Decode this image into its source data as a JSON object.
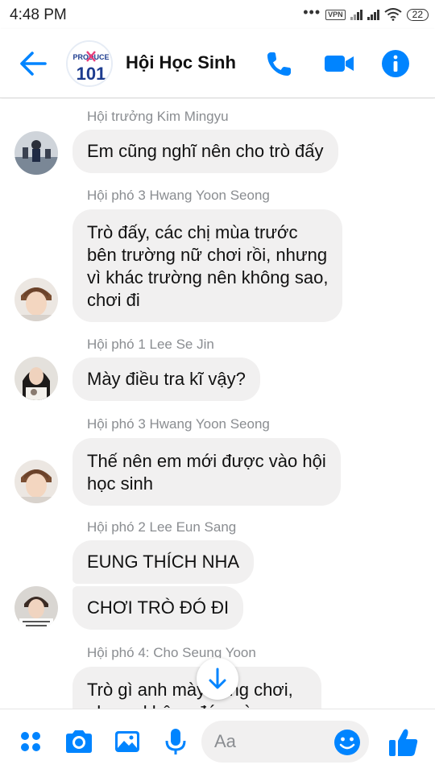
{
  "status_bar": {
    "time": "4:48 PM",
    "vpn_label": "VPN",
    "battery": "22"
  },
  "header": {
    "title": "Hội Học Sinh",
    "group_logo_top": "PRODUCE",
    "group_logo_bottom": "101"
  },
  "messages": [
    {
      "sender": "Hội trưởng Kim Mingyu",
      "lines": [
        "Em cũng nghĩ nên cho trò đấy"
      ]
    },
    {
      "sender": "Hội phó 3 Hwang Yoon Seong",
      "lines": [
        "Trò đấy, các chị mùa trước",
        "bên trường nữ chơi rồi, nhưng",
        "vì khác trường nên không sao,",
        "chơi đi"
      ]
    },
    {
      "sender": "Hội phó 1 Lee Se Jin",
      "lines": [
        "Mày điều tra kĩ vậy?"
      ]
    },
    {
      "sender": "Hội phó 3 Hwang Yoon Seong",
      "lines": [
        "Thế nên em mới được vào hội",
        "học sinh"
      ]
    },
    {
      "sender": "Hội phó 2 Lee Eun Sang",
      "lines": [
        "EUNG THÍCH NHA"
      ]
    },
    {
      "sender": "",
      "lines": [
        "CHƠI TRÒ ĐÓ ĐI"
      ]
    },
    {
      "sender": "Hội phó 4: Cho Seung Yoon",
      "lines": [
        "Trò gì anh mày cũng chơi,",
        "nhưng không đứa nào quen"
      ]
    }
  ],
  "composer": {
    "placeholder": "Aa"
  },
  "colors": {
    "accent": "#0084ff",
    "bubble": "#f1f0f0",
    "meta_text": "#8a8d91"
  },
  "icons": {
    "back": "arrow-left-icon",
    "call": "phone-icon",
    "video": "video-camera-icon",
    "info": "info-icon",
    "scroll": "arrow-down-icon",
    "menu": "four-dots-icon",
    "camera": "camera-icon",
    "gallery": "image-icon",
    "mic": "microphone-icon",
    "emoji": "smiley-icon",
    "like": "thumbs-up-icon"
  }
}
